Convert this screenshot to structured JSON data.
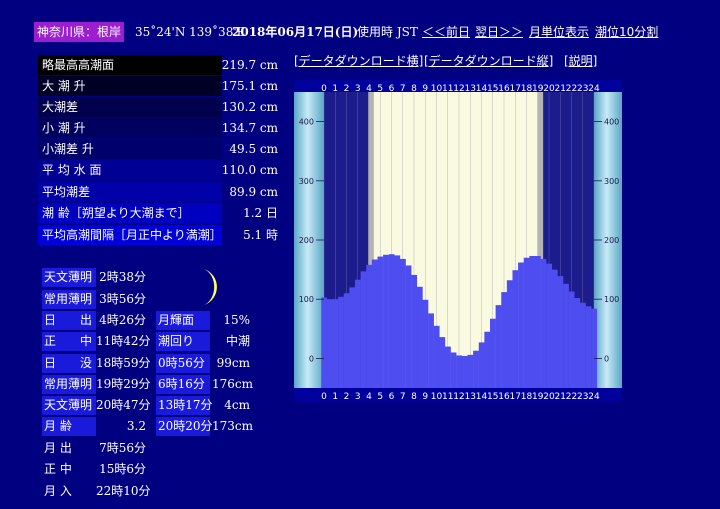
{
  "header": {
    "location": "神奈川県：根岸",
    "coords": "35˚24'N 139˚38'E",
    "date": "2018年06月17日(日)",
    "timezone": "使用時 JST",
    "prev_link": "＜＜前日",
    "next_link": "翌日＞＞",
    "monthly_link": "月単位表示",
    "interval_link": "潮位10分割"
  },
  "links": {
    "download_horizontal": "[データダウンロード横]",
    "download_vertical": "[データダウンロード縦]",
    "explanation": "[説明]"
  },
  "stats": [
    {
      "label": "略最高高潮面",
      "value": "219.7 cm"
    },
    {
      "label": "大 潮 升",
      "value": "175.1 cm"
    },
    {
      "label": "大潮差",
      "value": "130.2 cm"
    },
    {
      "label": "小 潮 升",
      "value": "134.7 cm"
    },
    {
      "label": "小潮差 升",
      "value": "49.5 cm"
    },
    {
      "label": "平 均 水 面",
      "value": "110.0 cm"
    },
    {
      "label": "平均潮差",
      "value": "89.9 cm"
    },
    {
      "label": "潮 齢［朔望より大潮まで］",
      "value": "1.2 日"
    },
    {
      "label": "平均高潮間隔［月正中より満潮］",
      "value": "5.1 時"
    }
  ],
  "sun_moon": [
    {
      "label": "天文薄明",
      "value": "2時38分"
    },
    {
      "label": "常用薄明",
      "value": "3時56分"
    },
    {
      "label": "日　　出",
      "value": "4時26分"
    },
    {
      "label": "正　　中",
      "value": "11時42分"
    },
    {
      "label": "日　　没",
      "value": "18時59分"
    },
    {
      "label": "常用薄明",
      "value": "19時29分"
    },
    {
      "label": "天文薄明",
      "value": "20時47分"
    },
    {
      "label": "月 齢",
      "value": "3.2"
    },
    {
      "label": "月 出",
      "value": "7時56分"
    },
    {
      "label": "正 中",
      "value": "15時6分"
    },
    {
      "label": "月 入",
      "value": "22時10分"
    }
  ],
  "moon_info": [
    {
      "label": "月輝面",
      "value": "15%"
    },
    {
      "label": "潮回り",
      "value": "中潮"
    }
  ],
  "tides": [
    {
      "time": "0時56分",
      "level": "99cm"
    },
    {
      "time": "6時16分",
      "level": "176cm"
    },
    {
      "time": "13時17分",
      "level": "4cm"
    },
    {
      "time": "20時20分",
      "level": "173cm"
    }
  ],
  "chart_data": {
    "type": "bar",
    "title": "",
    "x": [
      0,
      0.5,
      1,
      1.5,
      2,
      2.5,
      3,
      3.5,
      4,
      4.5,
      5,
      5.5,
      6,
      6.5,
      7,
      7.5,
      8,
      8.5,
      9,
      9.5,
      10,
      10.5,
      11,
      11.5,
      12,
      12.5,
      13,
      13.5,
      14,
      14.5,
      15,
      15.5,
      16,
      16.5,
      17,
      17.5,
      18,
      18.5,
      19,
      19.5,
      20,
      20.5,
      21,
      21.5,
      22,
      22.5,
      23,
      23.5,
      24
    ],
    "values": [
      103,
      100,
      100,
      104,
      110,
      120,
      133,
      147,
      158,
      167,
      172,
      175,
      176,
      174,
      168,
      157,
      141,
      121,
      99,
      76,
      55,
      36,
      20,
      10,
      5,
      4,
      6,
      13,
      27,
      45,
      67,
      90,
      112,
      132,
      149,
      162,
      170,
      173,
      173,
      168,
      160,
      150,
      139,
      126,
      113,
      102,
      94,
      88,
      84
    ],
    "x_ticks": [
      "0",
      "1",
      "2",
      "3",
      "4",
      "5",
      "6",
      "7",
      "8",
      "9",
      "10",
      "11",
      "12",
      "13",
      "14",
      "15",
      "16",
      "17",
      "18",
      "19",
      "20",
      "21",
      "22",
      "23",
      "24"
    ],
    "y_ticks": [
      "0",
      "100",
      "200",
      "300",
      "400"
    ],
    "ylim": [
      -50,
      450
    ],
    "xlim": [
      0,
      24
    ],
    "daylight": [
      4.43,
      18.98
    ],
    "twilight": [
      3.93,
      19.48
    ],
    "colors": {
      "bar": "#4d4df0",
      "night": "#1c1c8c",
      "day": "#fafae1",
      "twilight": "#b4b4b4",
      "panel": "#87cbe0",
      "axis": "#00009c"
    }
  }
}
